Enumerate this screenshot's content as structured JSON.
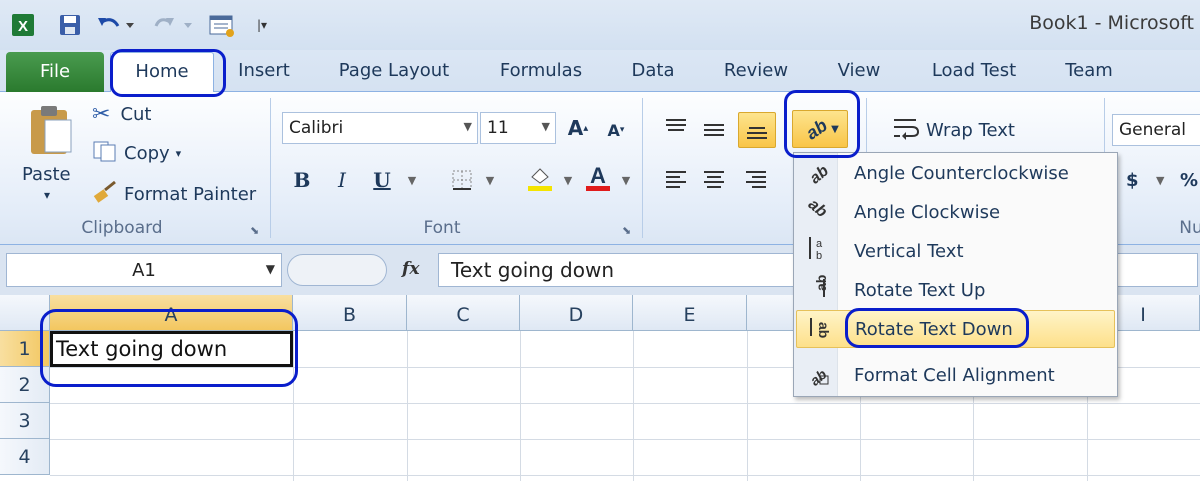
{
  "window": {
    "title": "Book1 - Microsoft"
  },
  "qat": {
    "icons": [
      "excel-logo-icon",
      "save-icon",
      "undo-icon",
      "redo-icon",
      "customize-icon"
    ]
  },
  "tabs": [
    {
      "label": "File"
    },
    {
      "label": "Home"
    },
    {
      "label": "Insert"
    },
    {
      "label": "Page Layout"
    },
    {
      "label": "Formulas"
    },
    {
      "label": "Data"
    },
    {
      "label": "Review"
    },
    {
      "label": "View"
    },
    {
      "label": "Load Test"
    },
    {
      "label": "Team"
    }
  ],
  "clipboard": {
    "paste": "Paste",
    "cut": "Cut",
    "copy": "Copy",
    "format_painter": "Format Painter",
    "group": "Clipboard"
  },
  "font": {
    "name": "Calibri",
    "size": "11",
    "bold": "B",
    "italic": "I",
    "underline": "U",
    "group": "Font",
    "font_color": "#e01b1b",
    "fill_color": "#f4e400"
  },
  "alignment": {
    "wrap_text": "Wrap Text"
  },
  "number": {
    "format": "General",
    "currency": "$",
    "percent": "%",
    "group_partial": "Nu"
  },
  "formula_bar": {
    "name_box": "A1",
    "fx": "fx",
    "content": "Text going down"
  },
  "grid": {
    "columns": [
      "A",
      "B",
      "C",
      "D",
      "E",
      "",
      "",
      "",
      "",
      "I"
    ],
    "rows": [
      "1",
      "2",
      "3",
      "4"
    ],
    "a1_value": "Text going down"
  },
  "orientation_menu": {
    "items": [
      {
        "label": "Angle Counterclockwise",
        "icon": "angle-ccw-icon"
      },
      {
        "label": "Angle Clockwise",
        "icon": "angle-cw-icon"
      },
      {
        "label": "Vertical Text",
        "icon": "vertical-text-icon"
      },
      {
        "label": "Rotate Text Up",
        "icon": "rotate-up-icon"
      },
      {
        "label": "Rotate Text Down",
        "icon": "rotate-down-icon"
      },
      {
        "label": "Format Cell Alignment",
        "icon": "format-alignment-icon"
      }
    ],
    "highlighted": "Rotate Text Down"
  },
  "annotation_color": "#0a1ecb"
}
